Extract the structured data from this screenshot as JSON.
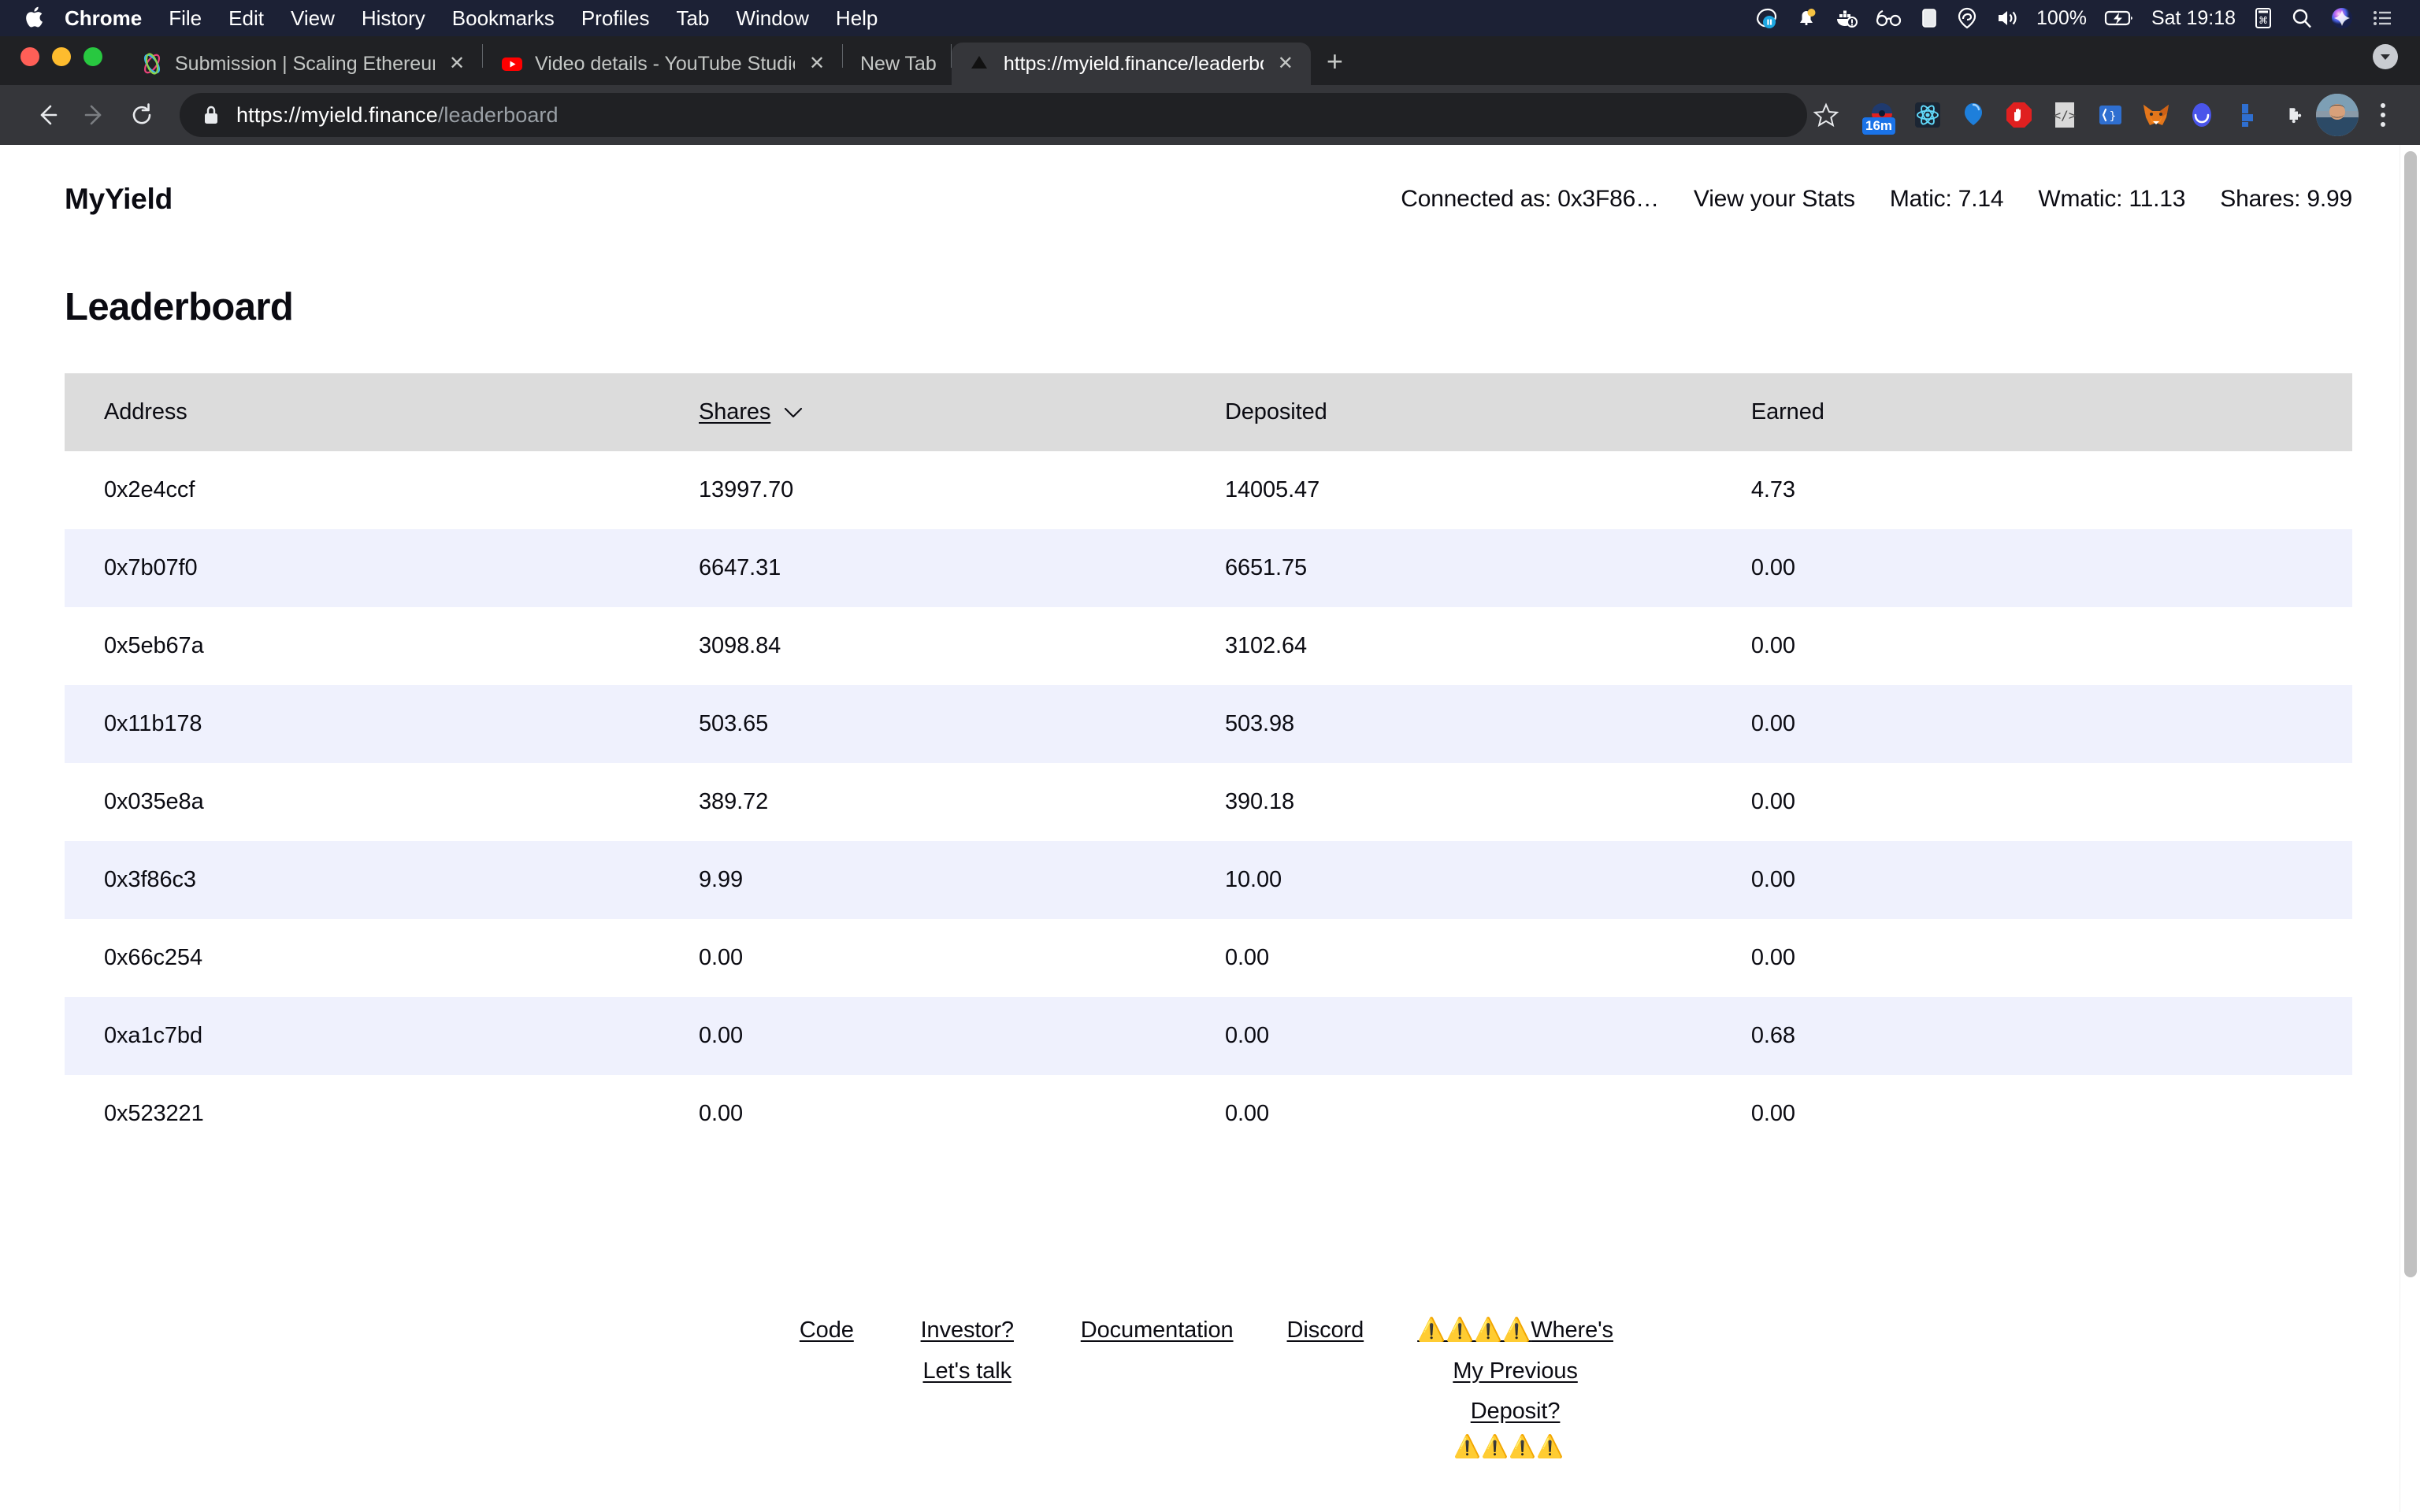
{
  "macos_menubar": {
    "apple_icon": "apple-logo",
    "menus": [
      "Chrome",
      "File",
      "Edit",
      "View",
      "History",
      "Bookmarks",
      "Profiles",
      "Tab",
      "Window",
      "Help"
    ],
    "status_icons": [
      "screen-recording-icon",
      "notification-bell-icon",
      "docker-icon",
      "reading-glasses-icon",
      "display-icon",
      "privacy-location-icon",
      "volume-icon"
    ],
    "battery_percent": "100%",
    "battery_icon": "battery-charging-icon",
    "clock": "Sat 19:18",
    "right_icons": [
      "keyboard-input-icon",
      "spotlight-search-icon",
      "siri-icon",
      "control-center-icon"
    ]
  },
  "browser": {
    "window_controls": [
      "close",
      "minimize",
      "maximize"
    ],
    "tabs": [
      {
        "title": "Submission | Scaling Ethereum",
        "favicon": "ethglobal-icon",
        "active": false,
        "closable": true
      },
      {
        "title": "Video details - YouTube Studio",
        "favicon": "youtube-icon",
        "active": false,
        "closable": true
      },
      {
        "title": "New Tab",
        "favicon": "none",
        "active": false,
        "closable": false
      },
      {
        "title": "https://myield.finance/leaderbo",
        "favicon": "vercel-icon",
        "active": true,
        "closable": true
      }
    ],
    "new_tab_label": "+",
    "tabstrip_right_icon": "download-chevron-icon",
    "nav": {
      "back_icon": "back-arrow-icon",
      "forward_icon": "forward-arrow-icon",
      "reload_icon": "reload-icon"
    },
    "omnibox": {
      "lock_icon": "lock-icon",
      "url_origin": "https://myield.finance",
      "url_path": "/leaderboard",
      "star_icon": "bookmark-star-icon"
    },
    "extensions": [
      {
        "name": "screen-recorder-extension",
        "badge": "16m",
        "color": "#1a73e8"
      },
      {
        "name": "react-devtools-extension",
        "badge": "",
        "color": "#61dafb"
      },
      {
        "name": "balloon-extension",
        "badge": "",
        "color": "#1e7fdb"
      },
      {
        "name": "adblock-stop-extension",
        "badge": "",
        "color": "#e02020"
      },
      {
        "name": "code-viewer-extension",
        "badge": "",
        "color": "#d9d9d9"
      },
      {
        "name": "json-viewer-extension",
        "badge": "",
        "color": "#2f6fd0"
      },
      {
        "name": "metamask-fox-extension",
        "badge": "",
        "color": "#e2761b"
      },
      {
        "name": "rainbow-wallet-extension",
        "badge": "",
        "color": "#4a55ea"
      },
      {
        "name": "blue-blocks-extension",
        "badge": "",
        "color": "#2f6fd0"
      },
      {
        "name": "extensions-puzzle-icon",
        "badge": "",
        "color": "#e8eaed"
      }
    ],
    "profile_avatar": "user-avatar",
    "menu_icon": "three-dot-menu-icon"
  },
  "site": {
    "brand": "MyYield",
    "nav": [
      {
        "label": "Connected as: 0x3F86…"
      },
      {
        "label": "View your Stats"
      },
      {
        "label": "Matic: 7.14"
      },
      {
        "label": "Wmatic: 11.13"
      },
      {
        "label": "Shares: 9.99"
      }
    ],
    "page_title": "Leaderboard",
    "table": {
      "columns": [
        {
          "key": "address",
          "label": "Address",
          "sortable": false,
          "sorted": false
        },
        {
          "key": "shares",
          "label": "Shares",
          "sortable": true,
          "sorted": true,
          "sort_dir": "desc",
          "sort_icon": "chevron-down-icon"
        },
        {
          "key": "deposited",
          "label": "Deposited",
          "sortable": false,
          "sorted": false
        },
        {
          "key": "earned",
          "label": "Earned",
          "sortable": false,
          "sorted": false
        }
      ],
      "rows": [
        {
          "address": "0x2e4ccf",
          "shares": "13997.70",
          "deposited": "14005.47",
          "earned": "4.73"
        },
        {
          "address": "0x7b07f0",
          "shares": "6647.31",
          "deposited": "6651.75",
          "earned": "0.00"
        },
        {
          "address": "0x5eb67a",
          "shares": "3098.84",
          "deposited": "3102.64",
          "earned": "0.00"
        },
        {
          "address": "0x11b178",
          "shares": "503.65",
          "deposited": "503.98",
          "earned": "0.00"
        },
        {
          "address": "0x035e8a",
          "shares": "389.72",
          "deposited": "390.18",
          "earned": "0.00"
        },
        {
          "address": "0x3f86c3",
          "shares": "9.99",
          "deposited": "10.00",
          "earned": "0.00"
        },
        {
          "address": "0x66c254",
          "shares": "0.00",
          "deposited": "0.00",
          "earned": "0.00"
        },
        {
          "address": "0xa1c7bd",
          "shares": "0.00",
          "deposited": "0.00",
          "earned": "0.68"
        },
        {
          "address": "0x523221",
          "shares": "0.00",
          "deposited": "0.00",
          "earned": "0.00"
        }
      ]
    },
    "footer": {
      "links": [
        {
          "label": "Code"
        },
        {
          "label": "Investor? Let's talk"
        },
        {
          "label": "Documentation"
        },
        {
          "label": "Discord"
        }
      ],
      "warning_link": {
        "prefix": "⚠️⚠️⚠️⚠️",
        "label": "Where's My Previous Deposit?",
        "suffix": "⚠️⚠️⚠️⚠️"
      }
    },
    "colors": {
      "header_bg": "#dcdcdc",
      "alt_row_bg": "#eff1fd",
      "text": "#0b0b12",
      "page_bg": "#ffffff"
    }
  }
}
